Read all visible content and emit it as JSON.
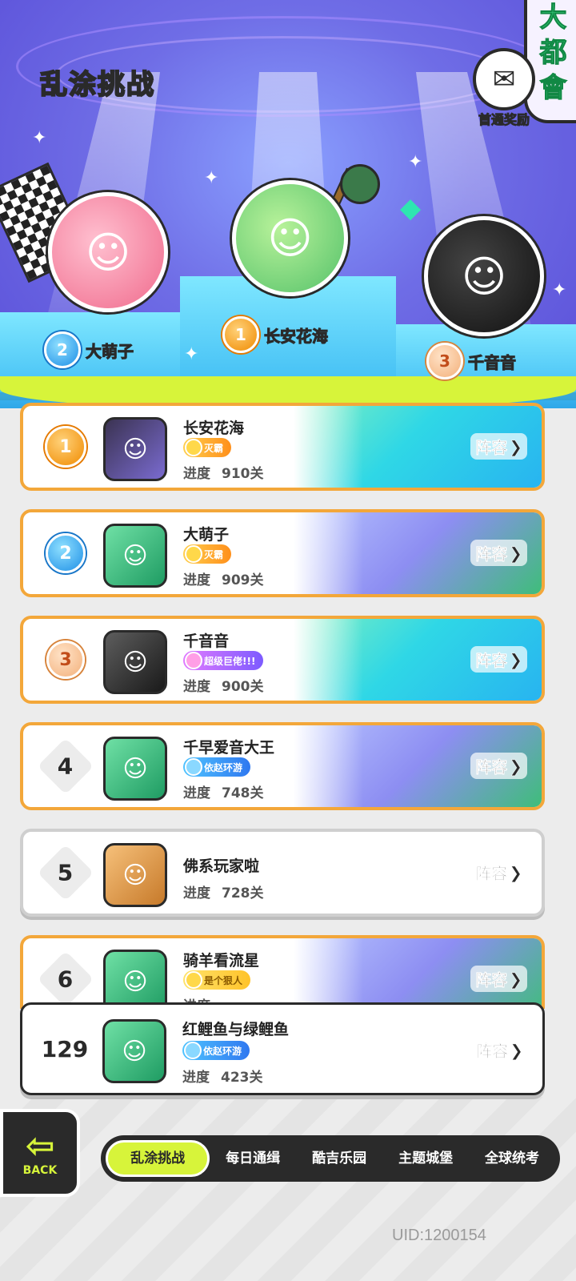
{
  "header": {
    "title": "乱涂挑战",
    "reward_label": "首通奖励",
    "corner_text": [
      "大",
      "都",
      "會"
    ]
  },
  "podium": [
    {
      "rank": "1",
      "name": "长安花海"
    },
    {
      "rank": "2",
      "name": "大萌子"
    },
    {
      "rank": "3",
      "name": "千音音"
    }
  ],
  "progress_label": "进度",
  "lineup_label": "阵容",
  "leaderboard": [
    {
      "rank": "1",
      "name": "长安花海",
      "badge": "灭霸",
      "progress": "910关"
    },
    {
      "rank": "2",
      "name": "大萌子",
      "badge": "灭霸",
      "progress": "909关"
    },
    {
      "rank": "3",
      "name": "千音音",
      "badge": "超级巨佬!!!",
      "progress": "900关"
    },
    {
      "rank": "4",
      "name": "千早爱音大王",
      "badge": "依赵环游",
      "progress": "748关"
    },
    {
      "rank": "5",
      "name": "佛系玩家啦",
      "badge": "",
      "progress": "728关"
    },
    {
      "rank": "6",
      "name": "骑羊看流星",
      "badge": "是个狠人",
      "progress": ""
    }
  ],
  "self": {
    "rank": "129",
    "name": "红鲤鱼与绿鲤鱼",
    "badge": "依赵环游",
    "progress": "423关"
  },
  "back_label": "BACK",
  "tabs": [
    "乱涂挑战",
    "每日通缉",
    "酷吉乐园",
    "主题城堡",
    "全球统考"
  ],
  "uid": "UID:1200154"
}
